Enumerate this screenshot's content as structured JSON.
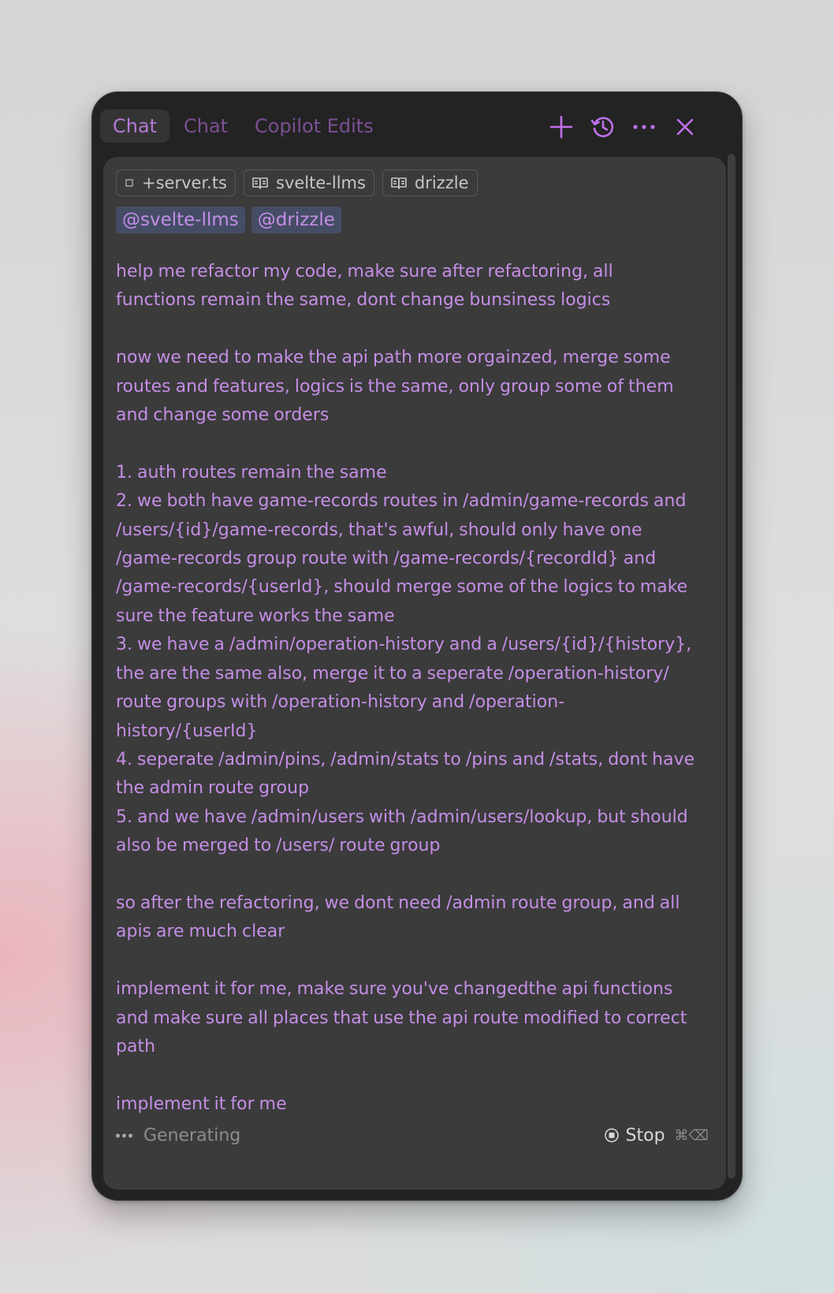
{
  "tabs": [
    {
      "label": "Chat",
      "active": true
    },
    {
      "label": "Chat",
      "active": false
    },
    {
      "label": "Copilot Edits",
      "active": false
    }
  ],
  "header_icons": [
    "plus-icon",
    "history-icon",
    "more-icon",
    "close-icon"
  ],
  "context_chips": [
    {
      "icon": "file-icon",
      "label": "+server.ts"
    },
    {
      "icon": "book-icon",
      "label": "svelte-llms"
    },
    {
      "icon": "book-icon",
      "label": "drizzle"
    }
  ],
  "mentions": [
    "@svelte-llms",
    "@drizzle"
  ],
  "message": "help me refactor my code, make sure after refactoring, all\nfunctions remain the same, dont change bunsiness logics\n\nnow we need to make the api path more orgainzed, merge some\nroutes and features, logics is the same, only group some of them\nand change some orders\n\n1. auth routes remain the same\n2. we both have game-records routes in /admin/game-records and\n/users/{id}/game-records, that's awful, should only have one\n/game-records group route with /game-records/{recordId} and\n/game-records/{userId}, should merge some of the logics to make\nsure the feature works the same\n3. we have a /admin/operation-history and a /users/{id}/{history},\nthe are the same also, merge it to a seperate /operation-history/\nroute groups with  /operation-history and  /operation-\nhistory/{userId}\n4. seperate /admin/pins, /admin/stats to /pins and /stats, dont have\nthe admin route group\n5. and we have /admin/users with  /admin/users/lookup, but should\nalso be merged to /users/ route group\n\nso after the refactoring, we dont need /admin route group, and all\napis are much clear\n\nimplement it for me, make sure you've changedthe api functions\nand make sure all places that use the api route modified to correct\npath\n\nimplement it for me",
  "footer": {
    "status": "Generating",
    "stop_label": "Stop",
    "shortcut": "⌘⌫"
  },
  "colors": {
    "accent": "#c48ee6",
    "tab_inactive": "#7b4f93",
    "panel_bg": "#232323",
    "card_bg": "#3b3b3b",
    "mention_bg": "#454d66"
  }
}
